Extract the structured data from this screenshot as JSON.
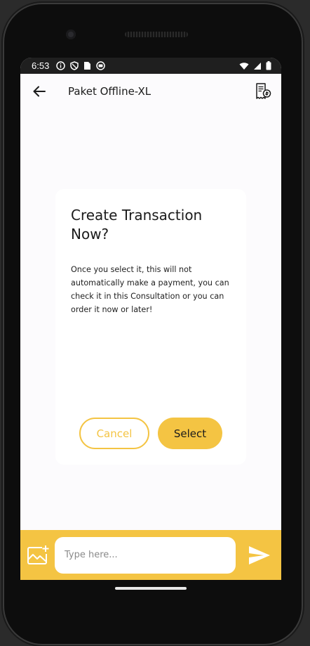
{
  "status_bar": {
    "time": "6:53",
    "icons": [
      "info-icon",
      "shield-icon",
      "sim-card-icon",
      "circle-app-icon"
    ],
    "right_icons": [
      "wifi-icon",
      "signal-icon",
      "battery-icon"
    ]
  },
  "app_bar": {
    "title": "Paket Offline-XL",
    "back_icon": "arrow-left-icon",
    "action_icon": "receipt-icon"
  },
  "dialog": {
    "heading": "Create Transaction Now?",
    "body": "Once you select it, this will not automatically make a payment, you can check it in this Consultation or you can order it now or later!",
    "cancel_label": "Cancel",
    "select_label": "Select"
  },
  "composer": {
    "placeholder": "Type here...",
    "value": "",
    "attach_icon": "add-image-icon",
    "send_icon": "send-icon"
  },
  "colors": {
    "accent": "#f4c443",
    "background": "#fcfbfd",
    "status_bar": "#1f1f1f",
    "text": "#1b1b1b"
  }
}
